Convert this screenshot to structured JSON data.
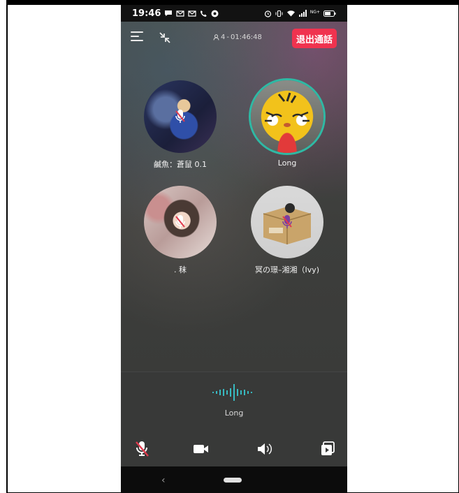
{
  "status_bar": {
    "time": "19:46",
    "notification_icons": [
      "chat-icon",
      "gmail-icon",
      "gmail-icon",
      "phone-icon",
      "chrome-icon"
    ],
    "system_icons": [
      "alarm-icon",
      "vibrate-icon",
      "wifi-icon",
      "signal-icon",
      "battery-icon"
    ],
    "network_label": "NG+"
  },
  "header": {
    "participants_count": "4",
    "call_duration": "01:46:48",
    "exit_label": "退出通話"
  },
  "participants": [
    {
      "name": "鹹魚：蒼鼠 0.1",
      "muted": true,
      "speaking": false
    },
    {
      "name": "Long",
      "muted": false,
      "speaking": true
    },
    {
      "name": ". 秣",
      "muted": true,
      "speaking": false
    },
    {
      "name": "冥の璟–湘湘（Ivy)",
      "muted": true,
      "speaking": false
    }
  ],
  "speaker": {
    "current_speaker": "Long"
  },
  "controls": {
    "mic": "mic-off-icon",
    "video": "video-camera-icon",
    "speaker": "speaker-icon",
    "share": "screen-share-icon"
  },
  "colors": {
    "accent_exit": "#f0334f",
    "speaking_ring": "#2fb9a4",
    "mute_red": "#e03a4d"
  }
}
